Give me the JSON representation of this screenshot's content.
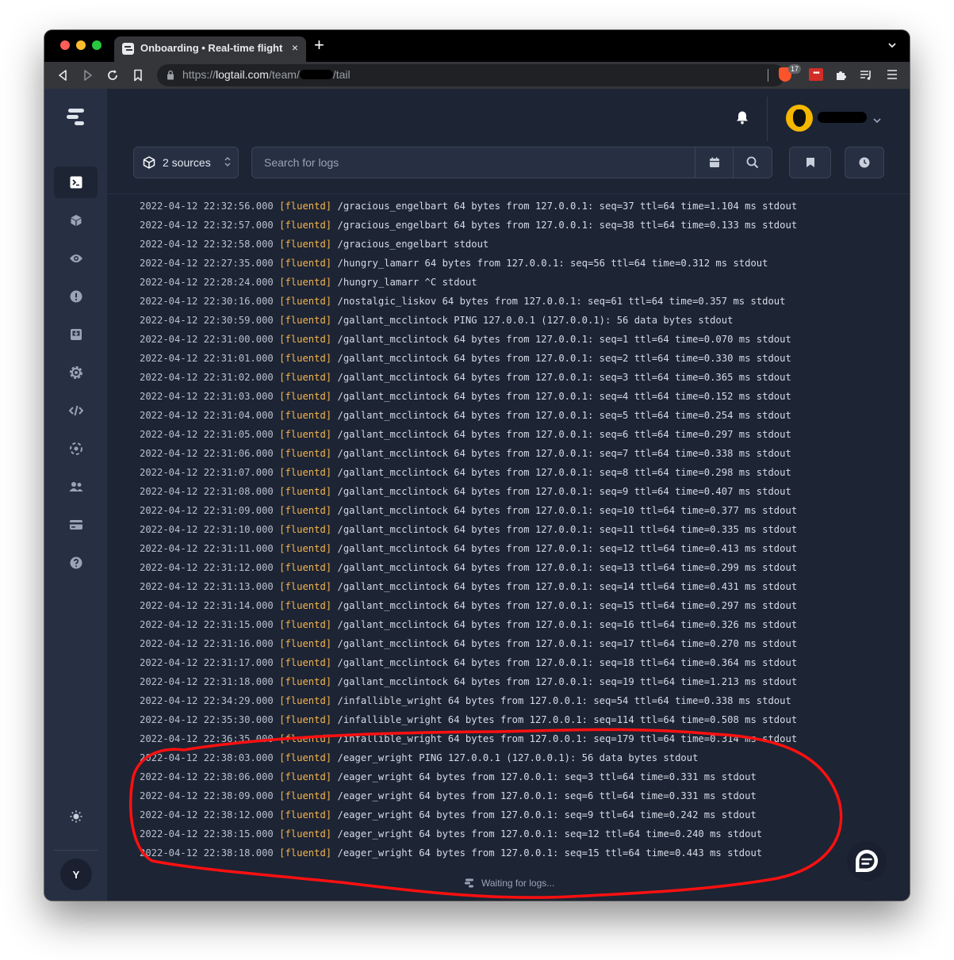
{
  "browser": {
    "tab_title": "Onboarding • Real-time flights,",
    "tab_close": "×",
    "new_tab": "+",
    "url_prefix": "https://",
    "url_domain": "logtail.com",
    "url_path": "/team/",
    "url_suffix": "/tail",
    "brave_badge": "17",
    "extension_label": "•••"
  },
  "toolbar": {
    "sources_label": "2 sources",
    "search_placeholder": "Search for logs"
  },
  "sidebar": {
    "items": [
      {
        "icon": "terminal-icon",
        "active": true
      },
      {
        "icon": "cube-icon"
      },
      {
        "icon": "eye-icon"
      },
      {
        "icon": "alert-icon"
      },
      {
        "icon": "inbox-icon"
      },
      {
        "icon": "gear-icon"
      },
      {
        "icon": "code-icon"
      },
      {
        "icon": "integrations-icon"
      },
      {
        "icon": "team-icon"
      },
      {
        "icon": "billing-icon"
      },
      {
        "icon": "help-icon"
      }
    ],
    "theme_icon": "sun-icon",
    "user_initial": "Y"
  },
  "logs": [
    {
      "ts": "2022-04-12 22:32:56.000",
      "tag": "[fluentd]",
      "msg": "/gracious_engelbart 64 bytes from 127.0.0.1: seq=37 ttl=64 time=1.104 ms stdout"
    },
    {
      "ts": "2022-04-12 22:32:57.000",
      "tag": "[fluentd]",
      "msg": "/gracious_engelbart 64 bytes from 127.0.0.1: seq=38 ttl=64 time=0.133 ms stdout"
    },
    {
      "ts": "2022-04-12 22:32:58.000",
      "tag": "[fluentd]",
      "msg": "/gracious_engelbart stdout"
    },
    {
      "ts": "2022-04-12 22:27:35.000",
      "tag": "[fluentd]",
      "msg": "/hungry_lamarr 64 bytes from 127.0.0.1: seq=56 ttl=64 time=0.312 ms stdout"
    },
    {
      "ts": "2022-04-12 22:28:24.000",
      "tag": "[fluentd]",
      "msg": "/hungry_lamarr ^C stdout"
    },
    {
      "ts": "2022-04-12 22:30:16.000",
      "tag": "[fluentd]",
      "msg": "/nostalgic_liskov 64 bytes from 127.0.0.1: seq=61 ttl=64 time=0.357 ms stdout"
    },
    {
      "ts": "2022-04-12 22:30:59.000",
      "tag": "[fluentd]",
      "msg": "/gallant_mcclintock PING 127.0.0.1 (127.0.0.1): 56 data bytes stdout"
    },
    {
      "ts": "2022-04-12 22:31:00.000",
      "tag": "[fluentd]",
      "msg": "/gallant_mcclintock 64 bytes from 127.0.0.1: seq=1 ttl=64 time=0.070 ms stdout"
    },
    {
      "ts": "2022-04-12 22:31:01.000",
      "tag": "[fluentd]",
      "msg": "/gallant_mcclintock 64 bytes from 127.0.0.1: seq=2 ttl=64 time=0.330 ms stdout"
    },
    {
      "ts": "2022-04-12 22:31:02.000",
      "tag": "[fluentd]",
      "msg": "/gallant_mcclintock 64 bytes from 127.0.0.1: seq=3 ttl=64 time=0.365 ms stdout"
    },
    {
      "ts": "2022-04-12 22:31:03.000",
      "tag": "[fluentd]",
      "msg": "/gallant_mcclintock 64 bytes from 127.0.0.1: seq=4 ttl=64 time=0.152 ms stdout"
    },
    {
      "ts": "2022-04-12 22:31:04.000",
      "tag": "[fluentd]",
      "msg": "/gallant_mcclintock 64 bytes from 127.0.0.1: seq=5 ttl=64 time=0.254 ms stdout"
    },
    {
      "ts": "2022-04-12 22:31:05.000",
      "tag": "[fluentd]",
      "msg": "/gallant_mcclintock 64 bytes from 127.0.0.1: seq=6 ttl=64 time=0.297 ms stdout"
    },
    {
      "ts": "2022-04-12 22:31:06.000",
      "tag": "[fluentd]",
      "msg": "/gallant_mcclintock 64 bytes from 127.0.0.1: seq=7 ttl=64 time=0.338 ms stdout"
    },
    {
      "ts": "2022-04-12 22:31:07.000",
      "tag": "[fluentd]",
      "msg": "/gallant_mcclintock 64 bytes from 127.0.0.1: seq=8 ttl=64 time=0.298 ms stdout"
    },
    {
      "ts": "2022-04-12 22:31:08.000",
      "tag": "[fluentd]",
      "msg": "/gallant_mcclintock 64 bytes from 127.0.0.1: seq=9 ttl=64 time=0.407 ms stdout"
    },
    {
      "ts": "2022-04-12 22:31:09.000",
      "tag": "[fluentd]",
      "msg": "/gallant_mcclintock 64 bytes from 127.0.0.1: seq=10 ttl=64 time=0.377 ms stdout"
    },
    {
      "ts": "2022-04-12 22:31:10.000",
      "tag": "[fluentd]",
      "msg": "/gallant_mcclintock 64 bytes from 127.0.0.1: seq=11 ttl=64 time=0.335 ms stdout"
    },
    {
      "ts": "2022-04-12 22:31:11.000",
      "tag": "[fluentd]",
      "msg": "/gallant_mcclintock 64 bytes from 127.0.0.1: seq=12 ttl=64 time=0.413 ms stdout"
    },
    {
      "ts": "2022-04-12 22:31:12.000",
      "tag": "[fluentd]",
      "msg": "/gallant_mcclintock 64 bytes from 127.0.0.1: seq=13 ttl=64 time=0.299 ms stdout"
    },
    {
      "ts": "2022-04-12 22:31:13.000",
      "tag": "[fluentd]",
      "msg": "/gallant_mcclintock 64 bytes from 127.0.0.1: seq=14 ttl=64 time=0.431 ms stdout"
    },
    {
      "ts": "2022-04-12 22:31:14.000",
      "tag": "[fluentd]",
      "msg": "/gallant_mcclintock 64 bytes from 127.0.0.1: seq=15 ttl=64 time=0.297 ms stdout"
    },
    {
      "ts": "2022-04-12 22:31:15.000",
      "tag": "[fluentd]",
      "msg": "/gallant_mcclintock 64 bytes from 127.0.0.1: seq=16 ttl=64 time=0.326 ms stdout"
    },
    {
      "ts": "2022-04-12 22:31:16.000",
      "tag": "[fluentd]",
      "msg": "/gallant_mcclintock 64 bytes from 127.0.0.1: seq=17 ttl=64 time=0.270 ms stdout"
    },
    {
      "ts": "2022-04-12 22:31:17.000",
      "tag": "[fluentd]",
      "msg": "/gallant_mcclintock 64 bytes from 127.0.0.1: seq=18 ttl=64 time=0.364 ms stdout"
    },
    {
      "ts": "2022-04-12 22:31:18.000",
      "tag": "[fluentd]",
      "msg": "/gallant_mcclintock 64 bytes from 127.0.0.1: seq=19 ttl=64 time=1.213 ms stdout"
    },
    {
      "ts": "2022-04-12 22:34:29.000",
      "tag": "[fluentd]",
      "msg": "/infallible_wright 64 bytes from 127.0.0.1: seq=54 ttl=64 time=0.338 ms stdout"
    },
    {
      "ts": "2022-04-12 22:35:30.000",
      "tag": "[fluentd]",
      "msg": "/infallible_wright 64 bytes from 127.0.0.1: seq=114 ttl=64 time=0.508 ms stdout"
    },
    {
      "ts": "2022-04-12 22:36:35.000",
      "tag": "[fluentd]",
      "msg": "/infallible_wright 64 bytes from 127.0.0.1: seq=179 ttl=64 time=0.314 ms stdout"
    },
    {
      "ts": "2022-04-12 22:38:03.000",
      "tag": "[fluentd]",
      "msg": "/eager_wright PING 127.0.0.1 (127.0.0.1): 56 data bytes stdout"
    },
    {
      "ts": "2022-04-12 22:38:06.000",
      "tag": "[fluentd]",
      "msg": "/eager_wright 64 bytes from 127.0.0.1: seq=3 ttl=64 time=0.331 ms stdout"
    },
    {
      "ts": "2022-04-12 22:38:09.000",
      "tag": "[fluentd]",
      "msg": "/eager_wright 64 bytes from 127.0.0.1: seq=6 ttl=64 time=0.331 ms stdout"
    },
    {
      "ts": "2022-04-12 22:38:12.000",
      "tag": "[fluentd]",
      "msg": "/eager_wright 64 bytes from 127.0.0.1: seq=9 ttl=64 time=0.242 ms stdout"
    },
    {
      "ts": "2022-04-12 22:38:15.000",
      "tag": "[fluentd]",
      "msg": "/eager_wright 64 bytes from 127.0.0.1: seq=12 ttl=64 time=0.240 ms stdout"
    },
    {
      "ts": "2022-04-12 22:38:18.000",
      "tag": "[fluentd]",
      "msg": "/eager_wright 64 bytes from 127.0.0.1: seq=15 ttl=64 time=0.443 ms stdout"
    }
  ],
  "status": {
    "waiting_text": "Waiting for logs..."
  },
  "colors": {
    "background": "#1d2434",
    "sidebar": "#273043",
    "log_tag": "#f4b54d",
    "annotation": "#ff0000"
  }
}
